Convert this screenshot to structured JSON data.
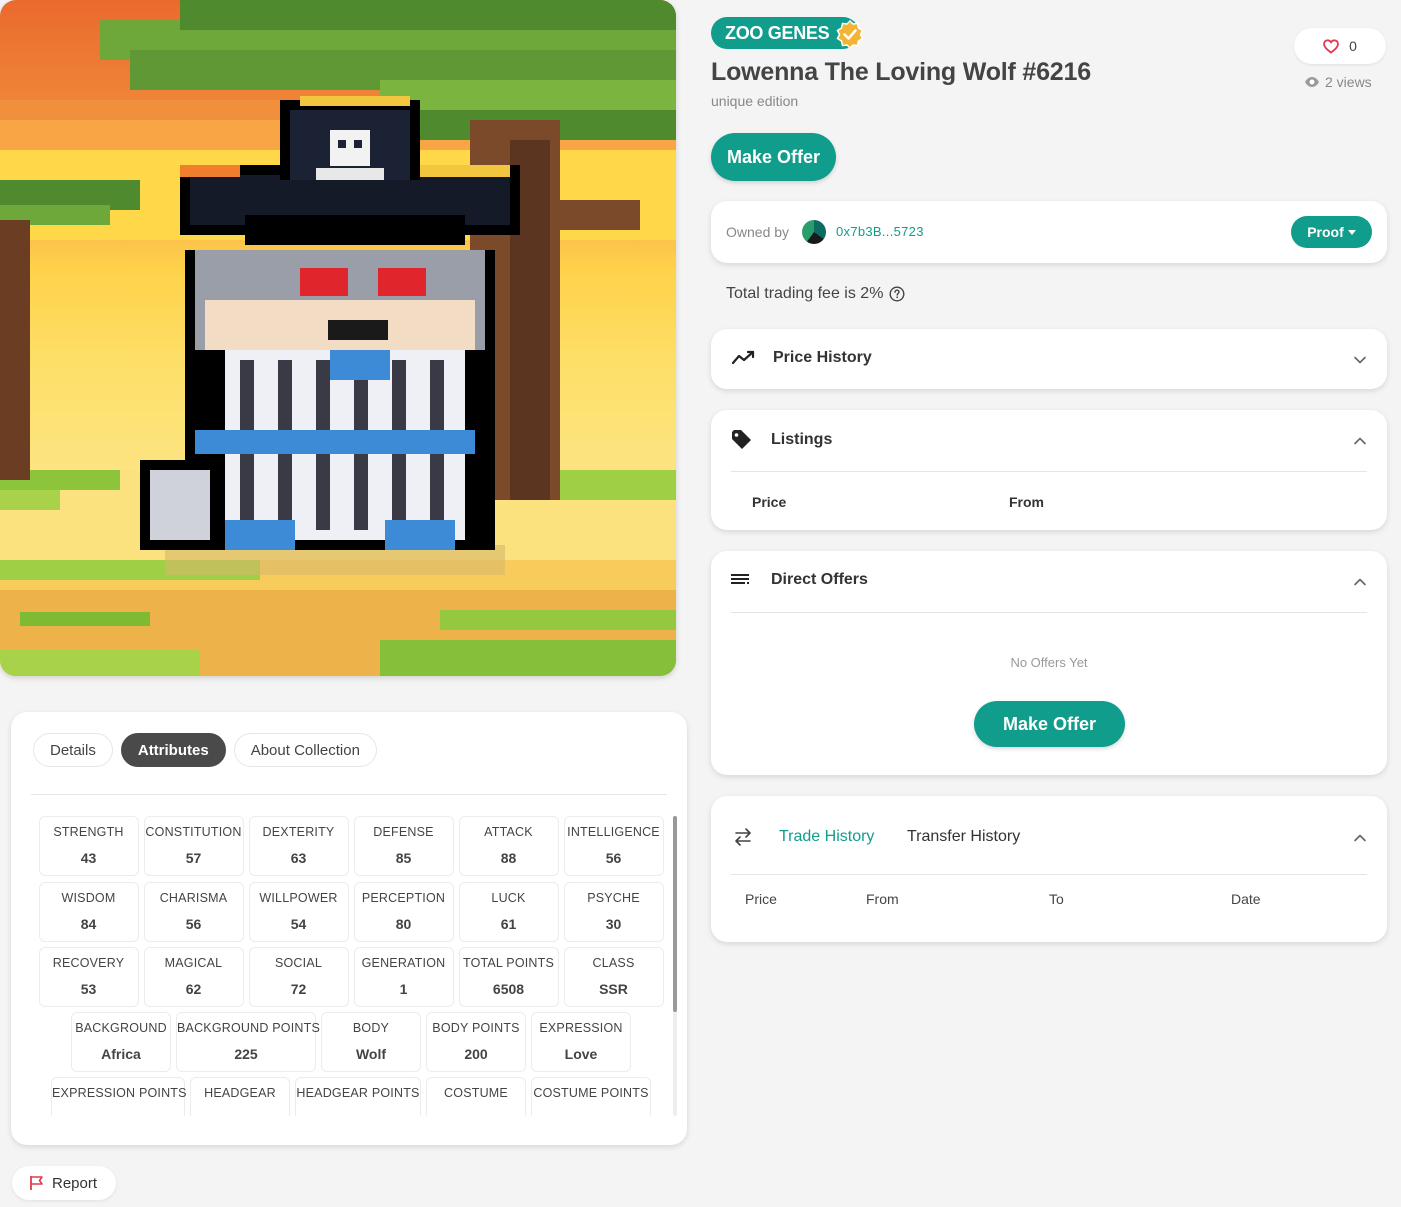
{
  "collection": {
    "name": "ZOO GENES",
    "verified": true
  },
  "nft": {
    "title": "Lowenna The Loving Wolf #6216",
    "edition": "unique edition"
  },
  "likes": {
    "count": "0"
  },
  "views": {
    "text": "2 views"
  },
  "actions": {
    "make_offer": "Make Offer",
    "report": "Report"
  },
  "owner": {
    "label": "Owned by",
    "address": "0x7b3B...5723",
    "proof_label": "Proof"
  },
  "fee": {
    "text": "Total trading fee is 2%"
  },
  "sections": {
    "price_history": "Price History",
    "listings": {
      "title": "Listings",
      "columns": [
        "Price",
        "From"
      ]
    },
    "direct_offers": {
      "title": "Direct Offers",
      "empty": "No Offers Yet"
    },
    "history": {
      "tabs": [
        "Trade History",
        "Transfer History"
      ],
      "columns": [
        "Price",
        "From",
        "To",
        "Date"
      ]
    }
  },
  "detail_tabs": [
    "Details",
    "Attributes",
    "About Collection"
  ],
  "attributes": [
    [
      {
        "k": "STRENGTH",
        "v": "43"
      },
      {
        "k": "CONSTITUTION",
        "v": "57"
      },
      {
        "k": "DEXTERITY",
        "v": "63"
      },
      {
        "k": "DEFENSE",
        "v": "85"
      },
      {
        "k": "ATTACK",
        "v": "88"
      },
      {
        "k": "INTELLIGENCE",
        "v": "56"
      }
    ],
    [
      {
        "k": "WISDOM",
        "v": "84"
      },
      {
        "k": "CHARISMA",
        "v": "56"
      },
      {
        "k": "WILLPOWER",
        "v": "54"
      },
      {
        "k": "PERCEPTION",
        "v": "80"
      },
      {
        "k": "LUCK",
        "v": "61"
      },
      {
        "k": "PSYCHE",
        "v": "30"
      }
    ],
    [
      {
        "k": "RECOVERY",
        "v": "53"
      },
      {
        "k": "MAGICAL",
        "v": "62"
      },
      {
        "k": "SOCIAL",
        "v": "72"
      },
      {
        "k": "GENERATION",
        "v": "1"
      },
      {
        "k": "TOTAL POINTS",
        "v": "6508"
      },
      {
        "k": "CLASS",
        "v": "SSR"
      }
    ],
    [
      {
        "k": "BACKGROUND",
        "v": "Africa"
      },
      {
        "k": "BACKGROUND POINTS",
        "v": "225"
      },
      {
        "k": "BODY",
        "v": "Wolf"
      },
      {
        "k": "BODY POINTS",
        "v": "200"
      },
      {
        "k": "EXPRESSION",
        "v": "Love"
      }
    ],
    [
      {
        "k": "EXPRESSION POINTS",
        "v": ""
      },
      {
        "k": "HEADGEAR",
        "v": ""
      },
      {
        "k": "HEADGEAR POINTS",
        "v": ""
      },
      {
        "k": "COSTUME",
        "v": ""
      },
      {
        "k": "COSTUME POINTS",
        "v": ""
      }
    ]
  ],
  "colors": {
    "accent": "#109d8c",
    "heart": "#e03a4f"
  }
}
